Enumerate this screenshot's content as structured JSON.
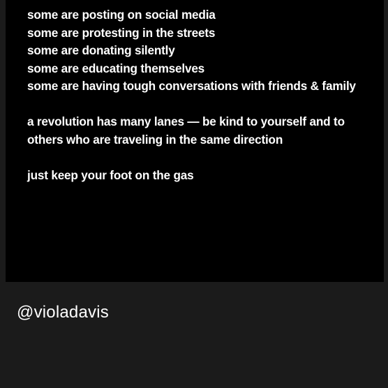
{
  "post": {
    "lines_group1": [
      "some are posting on social media",
      "some are protesting in the streets",
      "some are donating silently",
      "some are educating themselves",
      "some are having tough conversations with friends & family"
    ],
    "lines_group2": [
      "a revolution has many lanes — be kind to yourself and to",
      "others who are traveling in the same direction"
    ],
    "lines_group3": [
      "just keep your foot on the gas"
    ]
  },
  "caption": {
    "handle": "@violadavis"
  },
  "colors": {
    "image_background": "#000000",
    "page_background": "#1b1b1b",
    "text": "#ffffff"
  }
}
